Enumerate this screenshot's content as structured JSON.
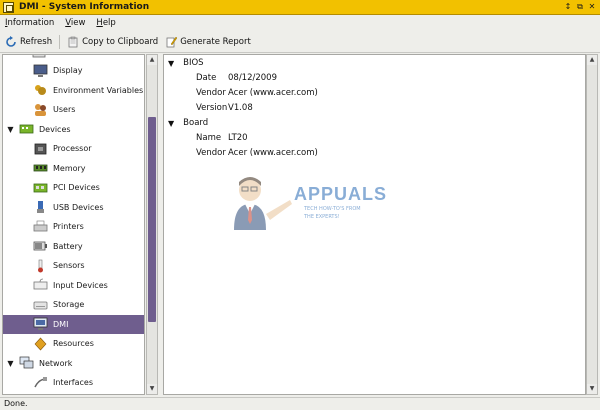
{
  "window": {
    "title": "DMI - System Information",
    "controls": [
      "↕",
      "⧉",
      "✕"
    ]
  },
  "menu": [
    "Information",
    "View",
    "Help"
  ],
  "toolbar": {
    "refresh": "Refresh",
    "copy": "Copy to Clipboard",
    "report": "Generate Report"
  },
  "sidebar": {
    "items": [
      {
        "label": "Display",
        "icon": "monitor-icon",
        "level": 1
      },
      {
        "label": "Environment Variables",
        "icon": "env-vars-icon",
        "level": 1
      },
      {
        "label": "Users",
        "icon": "users-icon",
        "level": 1
      },
      {
        "label": "Devices",
        "icon": "devices-icon",
        "level": 0,
        "expanded": true
      },
      {
        "label": "Processor",
        "icon": "processor-icon",
        "level": 1
      },
      {
        "label": "Memory",
        "icon": "memory-icon",
        "level": 1
      },
      {
        "label": "PCI Devices",
        "icon": "pci-icon",
        "level": 1
      },
      {
        "label": "USB Devices",
        "icon": "usb-icon",
        "level": 1
      },
      {
        "label": "Printers",
        "icon": "printer-icon",
        "level": 1
      },
      {
        "label": "Battery",
        "icon": "battery-icon",
        "level": 1
      },
      {
        "label": "Sensors",
        "icon": "thermometer-icon",
        "level": 1
      },
      {
        "label": "Input Devices",
        "icon": "keyboard-icon",
        "level": 1
      },
      {
        "label": "Storage",
        "icon": "storage-icon",
        "level": 1
      },
      {
        "label": "DMI",
        "icon": "dmi-icon",
        "level": 1,
        "selected": true
      },
      {
        "label": "Resources",
        "icon": "resources-icon",
        "level": 1
      },
      {
        "label": "Network",
        "icon": "network-icon",
        "level": 0,
        "expanded": true
      },
      {
        "label": "Interfaces",
        "icon": "interfaces-icon",
        "level": 1
      }
    ]
  },
  "content": {
    "bios": {
      "heading": "BIOS",
      "rows": [
        {
          "key": "Date",
          "value": "08/12/2009"
        },
        {
          "key": "Vendor",
          "value": "Acer (www.acer.com)"
        },
        {
          "key": "Version",
          "value": "V1.08"
        }
      ]
    },
    "board": {
      "heading": "Board",
      "rows": [
        {
          "key": "Name",
          "value": "LT20"
        },
        {
          "key": "Vendor",
          "value": "Acer (www.acer.com)"
        }
      ]
    }
  },
  "watermark": {
    "title": "APPUALS",
    "tagline_1": "TECH HOW-TO'S FROM",
    "tagline_2": "THE EXPERTS!"
  },
  "status": "Done.",
  "colors": {
    "titlebar": "#f2c100",
    "selection": "#6f5e8e",
    "scrollbar_thumb": "#6f5e8e"
  }
}
